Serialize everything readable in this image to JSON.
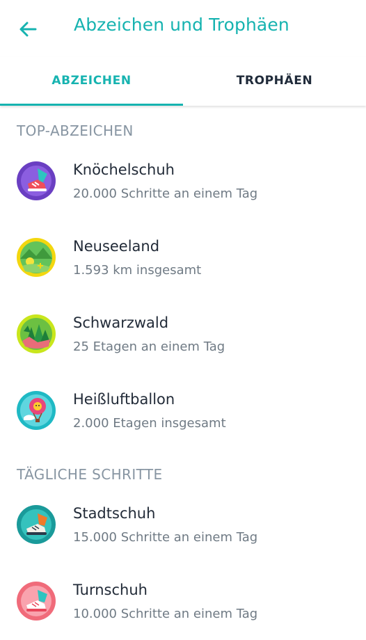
{
  "header": {
    "title": "Abzeichen und Trophäen"
  },
  "tabs": [
    {
      "label": "ABZEICHEN",
      "selected": true
    },
    {
      "label": "TROPHÄEN",
      "selected": false
    }
  ],
  "sections": [
    {
      "title": "TOP-ABZEICHEN",
      "items": [
        {
          "name": "Knöchelschuh",
          "desc": "20.000 Schritte an einem Tag",
          "icon": "ankle-shoe-badge-icon"
        },
        {
          "name": "Neuseeland",
          "desc": "1.593 km insgesamt",
          "icon": "new-zealand-badge-icon"
        },
        {
          "name": "Schwarzwald",
          "desc": "25 Etagen an einem Tag",
          "icon": "black-forest-badge-icon"
        },
        {
          "name": "Heißluftballon",
          "desc": "2.000 Etagen insgesamt",
          "icon": "hot-air-balloon-badge-icon"
        }
      ]
    },
    {
      "title": "TÄGLICHE SCHRITTE",
      "items": [
        {
          "name": "Stadtschuh",
          "desc": "15.000 Schritte an einem Tag",
          "icon": "city-shoe-badge-icon"
        },
        {
          "name": "Turnschuh",
          "desc": "10.000 Schritte an einem Tag",
          "icon": "sneaker-badge-icon"
        }
      ]
    }
  ],
  "colors": {
    "accent": "#16b3b0",
    "section": "#8795a2",
    "text": "#222b38",
    "subtext": "#6f7a84"
  }
}
